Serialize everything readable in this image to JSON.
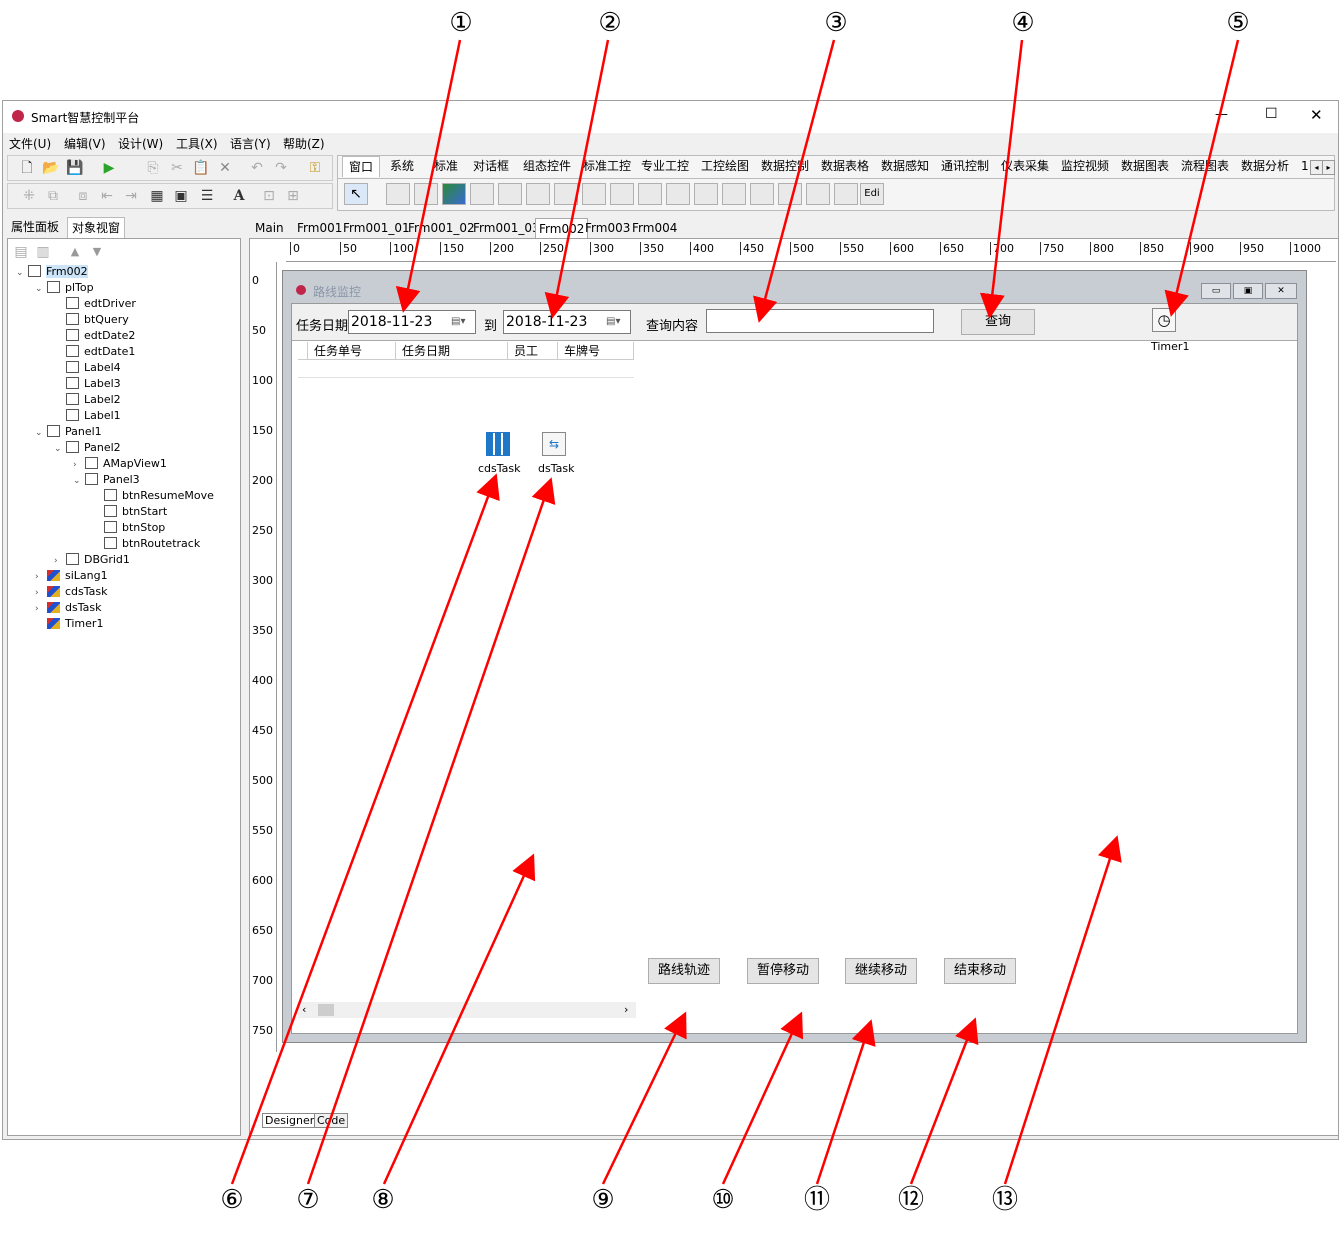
{
  "callouts": [
    "①",
    "②",
    "③",
    "④",
    "⑤",
    "⑥",
    "⑦",
    "⑧",
    "⑨",
    "⑩",
    "⑪",
    "⑫",
    "⑬"
  ],
  "app": {
    "title": "Smart智慧控制平台",
    "window_controls": {
      "minimize": "—",
      "maximize": "☐",
      "close": "✕"
    },
    "menu": [
      "文件(U)",
      "编辑(V)",
      "设计(W)",
      "工具(X)",
      "语言(Y)",
      "帮助(Z)"
    ],
    "palette_tabs": [
      "窗口",
      "系统",
      "标准",
      "对话框",
      "组态控件",
      "标准工控",
      "专业工控",
      "工控绘图",
      "数据控制",
      "数据表格",
      "数据感知",
      "通讯控制",
      "仪表采集",
      "监控视频",
      "数据图表",
      "流程图表",
      "数据分析"
    ],
    "palette_more": "1",
    "palette_edit_label": "Edi"
  },
  "left_panel": {
    "tabs": [
      "属性面板",
      "对象视窗"
    ],
    "tree": [
      {
        "label": "Frm002",
        "level": 0,
        "type": "form",
        "expanded": true
      },
      {
        "label": "plTop",
        "level": 1,
        "type": "panel",
        "expanded": true
      },
      {
        "label": "edtDriver",
        "level": 2,
        "type": "ctrl"
      },
      {
        "label": "btQuery",
        "level": 2,
        "type": "ctrl"
      },
      {
        "label": "edtDate2",
        "level": 2,
        "type": "ctrl"
      },
      {
        "label": "edtDate1",
        "level": 2,
        "type": "ctrl"
      },
      {
        "label": "Label4",
        "level": 2,
        "type": "ctrl"
      },
      {
        "label": "Label3",
        "level": 2,
        "type": "ctrl"
      },
      {
        "label": "Label2",
        "level": 2,
        "type": "ctrl"
      },
      {
        "label": "Label1",
        "level": 2,
        "type": "ctrl"
      },
      {
        "label": "Panel1",
        "level": 1,
        "type": "panel",
        "expanded": true
      },
      {
        "label": "Panel2",
        "level": 2,
        "type": "panel",
        "expanded": true
      },
      {
        "label": "AMapView1",
        "level": 3,
        "type": "ctrl",
        "collapsed": true
      },
      {
        "label": "Panel3",
        "level": 3,
        "type": "panel",
        "expanded": true
      },
      {
        "label": "btnResumeMove",
        "level": 4,
        "type": "ctrl"
      },
      {
        "label": "btnStart",
        "level": 4,
        "type": "ctrl"
      },
      {
        "label": "btnStop",
        "level": 4,
        "type": "ctrl"
      },
      {
        "label": "btnRoutetrack",
        "level": 4,
        "type": "ctrl"
      },
      {
        "label": "DBGrid1",
        "level": 2,
        "type": "ctrl",
        "collapsed": true
      },
      {
        "label": "siLang1",
        "level": 1,
        "type": "comp",
        "collapsed": true
      },
      {
        "label": "cdsTask",
        "level": 1,
        "type": "comp",
        "collapsed": true
      },
      {
        "label": "dsTask",
        "level": 1,
        "type": "comp",
        "collapsed": true
      },
      {
        "label": "Timer1",
        "level": 1,
        "type": "comp"
      }
    ]
  },
  "designer": {
    "tabs": [
      "Main",
      "Frm001",
      "Frm001_01",
      "Frm001_02",
      "Frm001_03",
      "Frm002",
      "Frm003",
      "Frm004"
    ],
    "active_tab": "Frm002",
    "ruler_h": [
      "0",
      "50",
      "100",
      "150",
      "200",
      "250",
      "300",
      "350",
      "400",
      "450",
      "500",
      "550",
      "600",
      "650",
      "700",
      "750",
      "800",
      "850",
      "900",
      "950",
      "1000"
    ],
    "ruler_v": [
      "0",
      "50",
      "100",
      "150",
      "200",
      "250",
      "300",
      "350",
      "400",
      "450",
      "500",
      "550",
      "600",
      "650",
      "700",
      "750"
    ],
    "bottom_tabs": [
      "Designer",
      "Code"
    ]
  },
  "form": {
    "caption": "路线监控",
    "label_task_date": "任务日期",
    "date_from": "2018-11-23",
    "label_to": "到",
    "date_to": "2018-11-23",
    "label_query_content": "查询内容",
    "query_input_value": "",
    "query_button": "查询",
    "timer_label": "Timer1",
    "grid_columns": [
      "任务单号",
      "任务日期",
      "员工",
      "车牌号"
    ],
    "cds_label": "cdsTask",
    "ds_label": "dsTask",
    "bottom_buttons": [
      "路线轨迹",
      "暂停移动",
      "继续移动",
      "结束移动"
    ]
  }
}
